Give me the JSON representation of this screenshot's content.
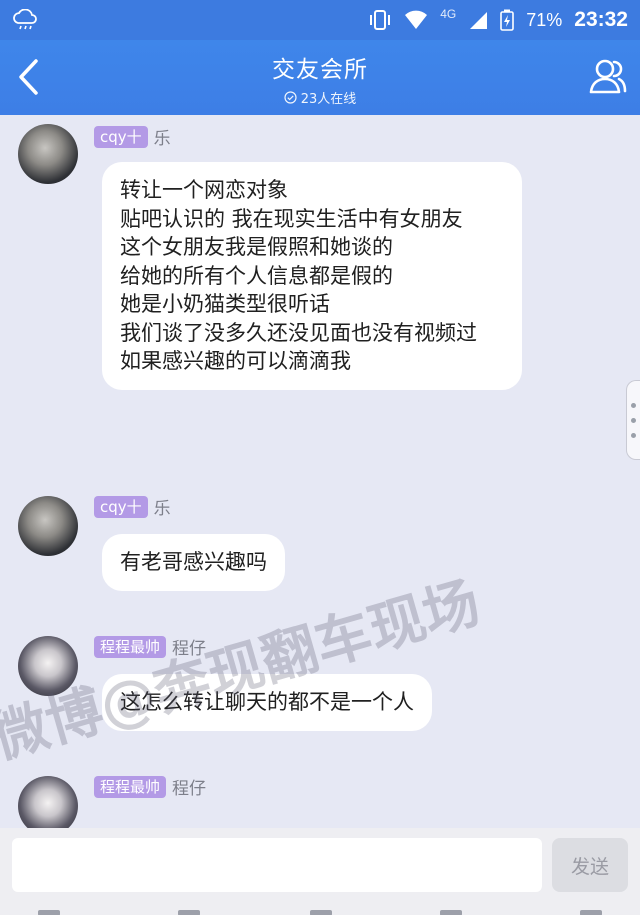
{
  "status_bar": {
    "network": "4G",
    "battery": "71%",
    "time": "23:32"
  },
  "header": {
    "title": "交友会所",
    "online": "23人在线"
  },
  "messages": [
    {
      "badge": "cqy十",
      "nick": "乐",
      "avatar": "boy-avatar",
      "text": "转让一个网恋对象\n贴吧认识的 我在现实生活中有女朋友\n这个女朋友我是假照和她谈的\n给她的所有个人信息都是假的\n她是小奶猫类型很听话\n我们谈了没多久还没见面也没有视频过\n如果感兴趣的可以滴滴我"
    },
    {
      "badge": "cqy十",
      "nick": "乐",
      "avatar": "boy-avatar",
      "text": "有老哥感兴趣吗"
    },
    {
      "badge": "程程最帅",
      "nick": "程仔",
      "avatar": "girl-avatar",
      "text": "这怎么转让聊天的都不是一个人"
    },
    {
      "badge": "程程最帅",
      "nick": "程仔",
      "avatar": "girl-avatar",
      "text": ""
    }
  ],
  "input": {
    "value": "",
    "send_label": "发送"
  },
  "watermark": "微博@奔现翻车现场",
  "colors": {
    "header": "#3d7ee6",
    "badge": "#b39ae6",
    "background": "#e6e8f4"
  }
}
